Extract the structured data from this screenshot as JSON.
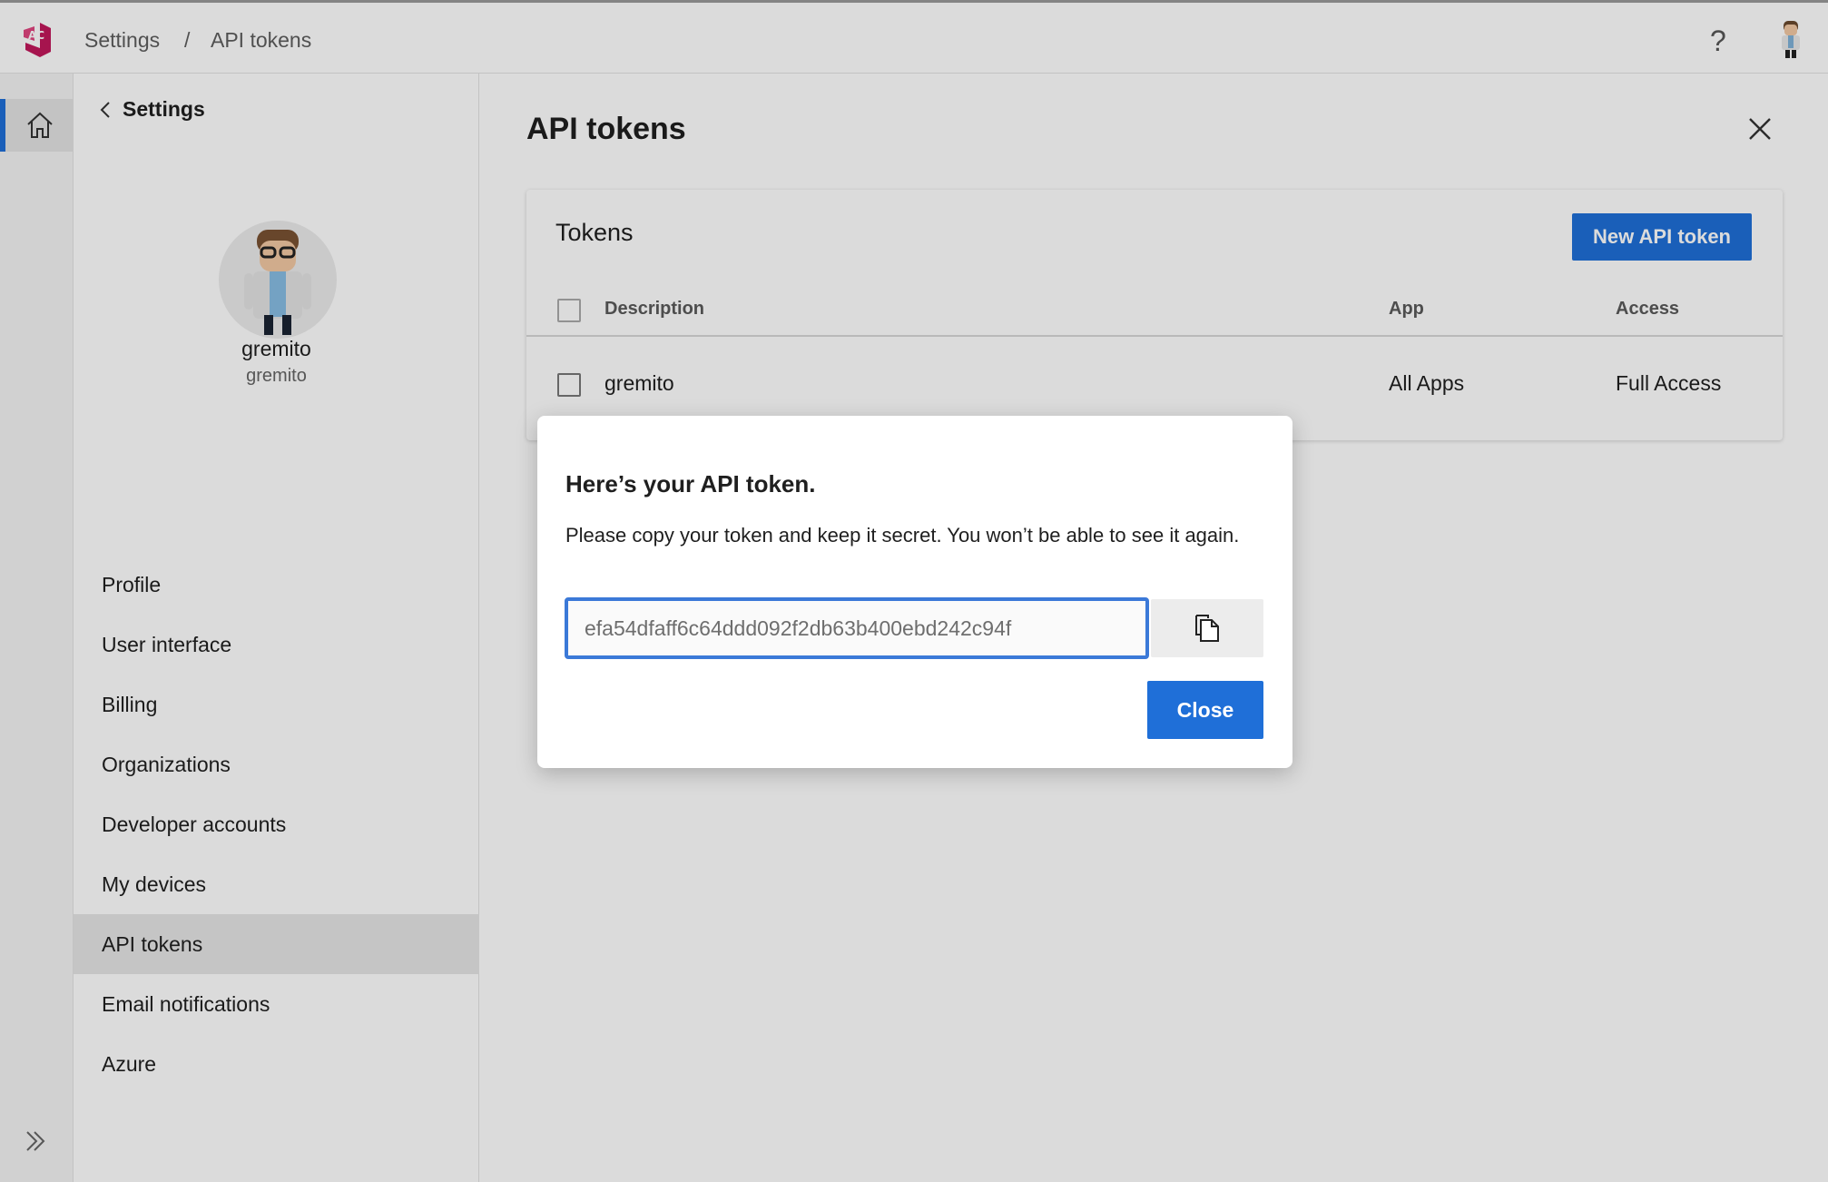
{
  "colors": {
    "accent": "#1f6fd8",
    "logo": "#c2185b"
  },
  "topbar": {
    "logo_icon": "app-logo-icon",
    "breadcrumb": [
      {
        "label": "Settings"
      },
      {
        "separator": "/"
      },
      {
        "label": "API tokens"
      }
    ],
    "help_label": "?",
    "avatar_icon": "user-avatar-icon"
  },
  "rail": {
    "home_icon": "home-icon",
    "expand_icon": "double-chevron-right-icon"
  },
  "settings_panel": {
    "back_label": "Settings",
    "user": {
      "display_name": "gremito",
      "username": "gremito"
    },
    "nav_items": [
      {
        "label": "Profile"
      },
      {
        "label": "User interface"
      },
      {
        "label": "Billing"
      },
      {
        "label": "Organizations"
      },
      {
        "label": "Developer accounts"
      },
      {
        "label": "My devices"
      },
      {
        "label": "API tokens",
        "active": true
      },
      {
        "label": "Email notifications"
      },
      {
        "label": "Azure"
      }
    ]
  },
  "main": {
    "title": "API tokens",
    "tokens_card": {
      "title": "Tokens",
      "new_button": "New API token",
      "columns": {
        "description": "Description",
        "app": "App",
        "access": "Access"
      },
      "rows": [
        {
          "description": "gremito",
          "app": "All Apps",
          "access": "Full Access"
        }
      ]
    }
  },
  "dialog": {
    "title": "Here’s your API token.",
    "message": "Please copy your token and keep it secret. You won’t be able to see it again.",
    "token_value": "efa54dfaff6c64ddd092f2db63b400ebd242c94f",
    "copy_icon": "copy-icon",
    "close_button": "Close"
  }
}
